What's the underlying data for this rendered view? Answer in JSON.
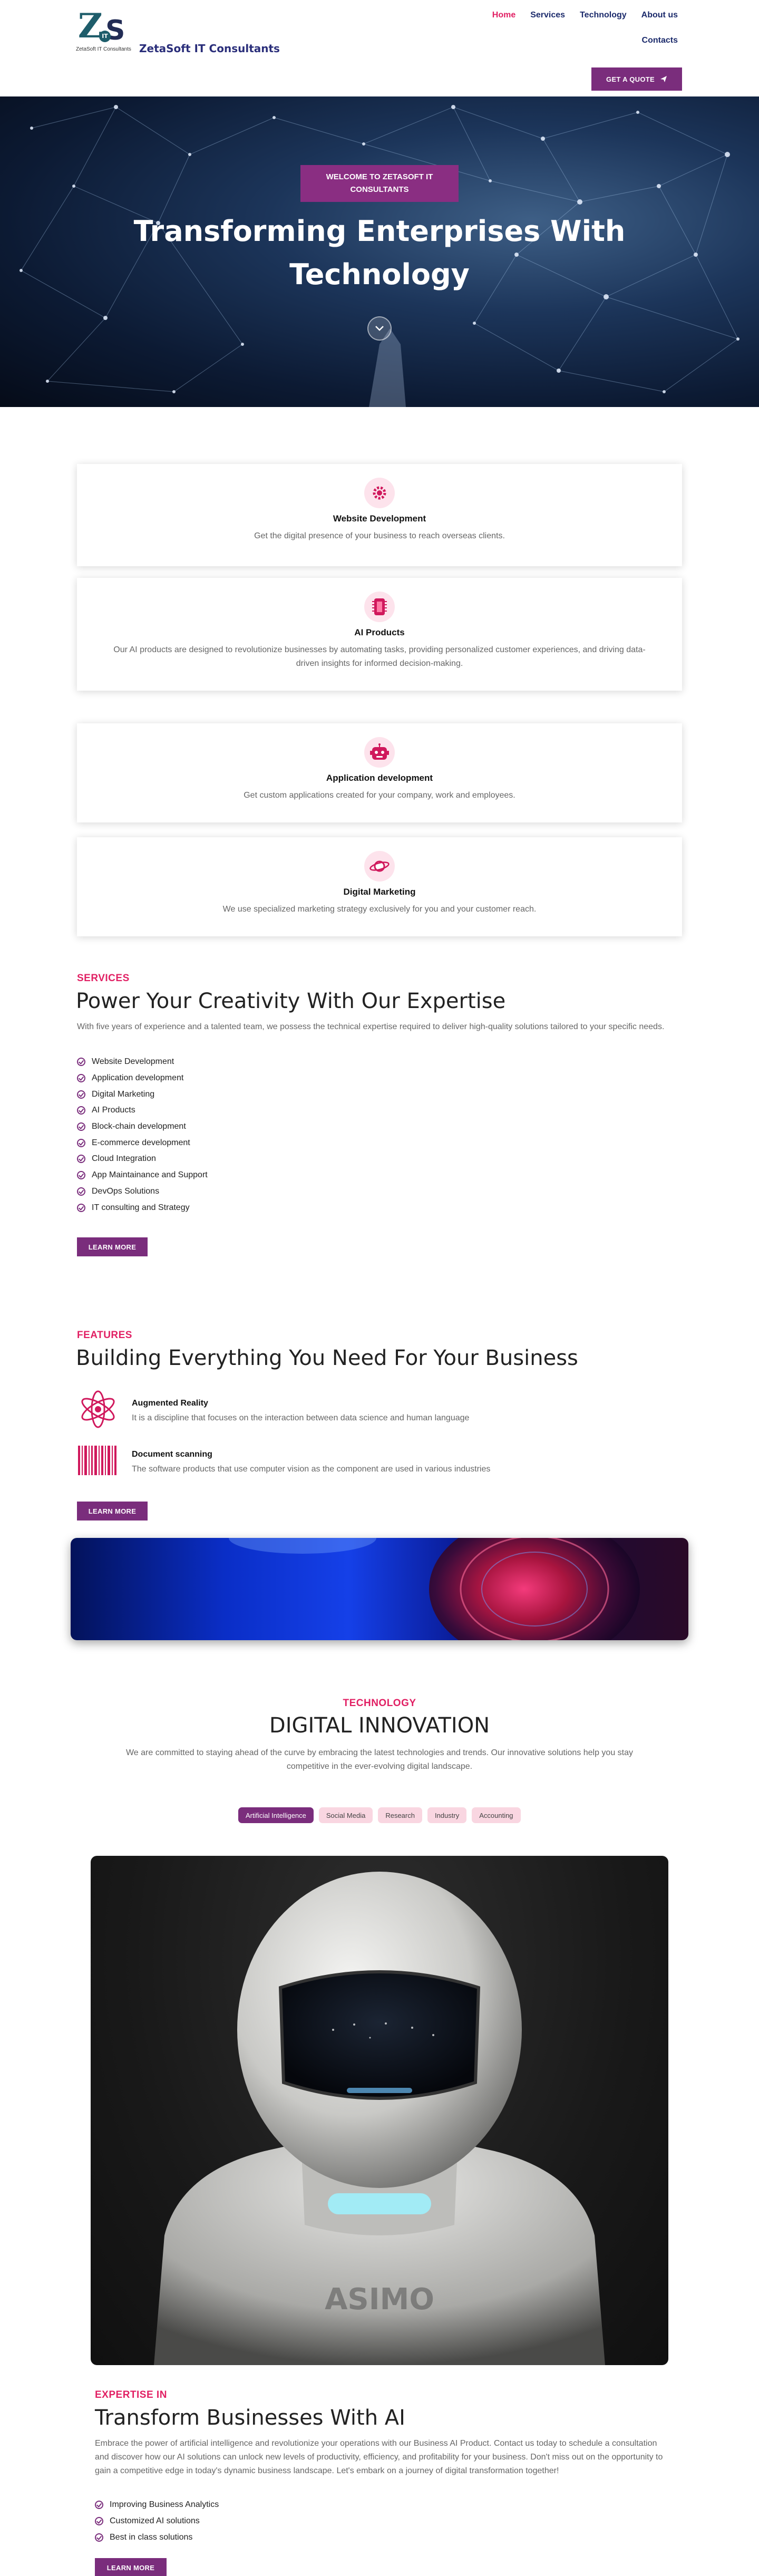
{
  "header": {
    "logo_letters": "ZS",
    "logo_it": "IT",
    "logo_sub": "ZetaSoft IT Consultants",
    "brand_name": "ZetaSoft IT Consultants",
    "nav": [
      "Home",
      "Services",
      "Technology",
      "About us"
    ],
    "nav_second": "Contacts",
    "quote_label": "GET A QUOTE",
    "accent": "#e11f63",
    "primary": "#7a2d7c"
  },
  "hero": {
    "badge_line1": "WELCOME TO ZETASOFT IT",
    "badge_line2": "CONSULTANTS",
    "title_line1": "Transforming Enterprises With",
    "title_line2": "Technology",
    "scroll_icon": "chevron-down-icon"
  },
  "cards": [
    {
      "icon": "gear-icon",
      "title": "Website Development",
      "desc": "Get the digital presence of your business to reach overseas clients."
    },
    {
      "icon": "chip-icon",
      "title": "AI Products",
      "desc": "Our AI products are designed to revolutionize businesses by automating tasks, providing personalized customer experiences, and driving data-driven insights for informed decision-making."
    },
    {
      "icon": "robot-icon",
      "title": "Application development",
      "desc": "Get custom applications created for your company, work and employees."
    },
    {
      "icon": "planet-icon",
      "title": "Digital Marketing",
      "desc": "We use specialized marketing strategy exclusively for you and your customer reach."
    }
  ],
  "services": {
    "eyebrow": "SERVICES",
    "heading": "Power Your Creativity With Our Expertise",
    "intro": "With five years of experience and a talented team, we possess the technical expertise required to deliver high-quality solutions tailored to your specific needs.",
    "items": [
      "Website Development",
      "Application development",
      "Digital Marketing",
      "AI Products",
      "Block-chain development",
      "E-commerce development",
      "Cloud Integration",
      "App Maintainance and Support",
      "DevOps Solutions",
      "IT consulting and Strategy"
    ],
    "button": "LEARN MORE"
  },
  "features": {
    "eyebrow": "FEATURES",
    "heading": "Building Everything You Need For Your Business",
    "items": [
      {
        "icon": "atom-icon",
        "title": "Augmented Reality",
        "desc": "It is a discipline that focuses on the interaction between data science and human language"
      },
      {
        "icon": "barcode-icon",
        "title": "Document scanning",
        "desc": "The software products that use computer vision as the component are used in various industries"
      }
    ],
    "button": "LEARN MORE"
  },
  "technology": {
    "eyebrow": "TECHNOLOGY",
    "heading": "DIGITAL INNOVATION",
    "intro_line1": "We are committed to staying ahead of the curve by embracing the latest technologies and trends. Our innovative solutions help you stay",
    "intro_line2": "competitive in the ever-evolving digital landscape.",
    "tabs": [
      "Artificial Intelligence",
      "Social Media",
      "Research",
      "Industry",
      "Accounting"
    ],
    "active_tab": "Artificial Intelligence",
    "robot_chest_text": "ASIMO"
  },
  "expertise": {
    "eyebrow": "EXPERTISE IN",
    "heading": "Transform Businesses With AI",
    "intro": "Embrace the power of artificial intelligence and revolutionize your operations with our Business AI Product. Contact us today to schedule a consultation and discover how our AI solutions can unlock new levels of productivity, efficiency, and profitability for your business. Don't miss out on the opportunity to gain a competitive edge in today's dynamic business landscape. Let's embark on a journey of digital transformation together!",
    "items": [
      "Improving Business Analytics",
      "Customized AI solutions",
      "Best in class solutions"
    ],
    "button": "LEARN MORE"
  }
}
